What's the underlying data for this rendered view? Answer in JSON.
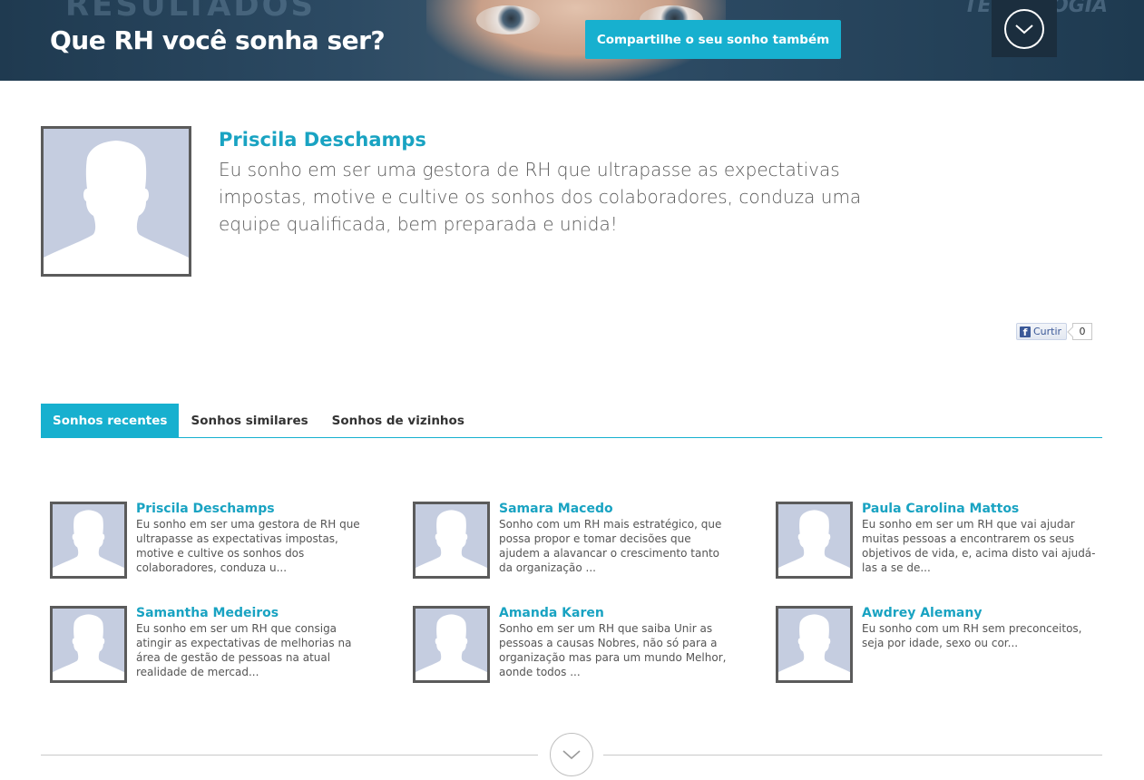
{
  "header": {
    "title": "Que RH você sonha ser?",
    "share_label": "Compartilhe o seu sonho também",
    "bg_word_left": "RESULTADOS",
    "bg_word_right": "TECNOLOGIA",
    "menu_icon": "chevron-down-icon",
    "colors": {
      "accent": "#17b0cf",
      "banner": "#2c4a63"
    }
  },
  "featured": {
    "name": "Priscila Deschamps",
    "text": "Eu sonho em ser uma gestora de RH que ultrapasse as expectativas impostas, motive e cultive os sonhos dos colaboradores, conduza uma equipe qualificada, bem preparada e unida!",
    "like_label": "Curtir",
    "like_count": "0"
  },
  "tabs": [
    {
      "label": "Sonhos recentes",
      "active": true
    },
    {
      "label": "Sonhos similares",
      "active": false
    },
    {
      "label": "Sonhos de vizinhos",
      "active": false
    }
  ],
  "dreams": [
    {
      "name": "Priscila Deschamps",
      "text": "Eu sonho em ser uma gestora de RH que ultrapasse as expectativas impostas, motive e cultive os sonhos dos colaboradores, conduza u..."
    },
    {
      "name": "Samara Macedo",
      "text": "Sonho com um RH mais estratégico, que possa propor e tomar decisões que ajudem a alavancar o crescimento tanto da organização ..."
    },
    {
      "name": "Paula Carolina Mattos",
      "text": "Eu sonho em ser um RH que vai ajudar muitas pessoas a encontrarem os seus objetivos de vida, e, acima disto vai ajudá-las a se de..."
    },
    {
      "name": "Samantha Medeiros",
      "text": "Eu sonho em ser um RH que consiga atingir as expectativas de melhorias na área de gestão de pessoas na atual realidade de mercad..."
    },
    {
      "name": "Amanda Karen",
      "text": "Sonho em ser um RH que saiba Unir as pessoas a causas Nobres, não só para a organização mas para um mundo Melhor, aonde todos ..."
    },
    {
      "name": "Awdrey Alemany",
      "text": "Eu sonho com um RH sem preconceitos, seja por idade, sexo ou cor..."
    }
  ],
  "more_icon": "chevron-down-icon"
}
